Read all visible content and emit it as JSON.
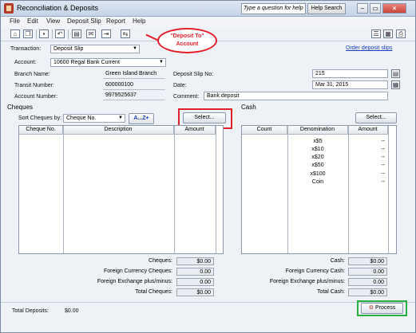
{
  "window": {
    "title": "Reconciliation & Deposits"
  },
  "help": {
    "placeholder": "Type a question for help",
    "search_label": "Help Search"
  },
  "window_controls": {
    "minimize": "–",
    "restore": "▭",
    "close": "×"
  },
  "menu": [
    "File",
    "Edit",
    "View",
    "Deposit Slip",
    "Report",
    "Help"
  ],
  "transaction": {
    "label": "Transaction:",
    "value": "Deposit Slip"
  },
  "order_link": "Order deposit slips",
  "callout": {
    "line1": "\"Deposit To\"",
    "line2": "Account"
  },
  "account": {
    "label": "Account:",
    "value": "10600 Regal Bank Current",
    "branch_label": "Branch Name:",
    "branch_value": "Green Island Branch",
    "transit_label": "Transit Number:",
    "transit_value": "600000100",
    "number_label": "Account Number:",
    "number_value": "9979525637"
  },
  "slip": {
    "number_label": "Deposit Slip No:",
    "number_value": "215",
    "date_label": "Date:",
    "date_value": "Mar 31, 2015",
    "comment_label": "Comment:",
    "comment_value": "Bank deposit"
  },
  "cheques": {
    "title": "Cheques",
    "sort_label": "Sort Cheques by:",
    "sort_value": "Cheque No.",
    "sort_button": "A...Z+",
    "select_button": "Select...",
    "columns": [
      "Cheque No.",
      "Description",
      "Amount"
    ],
    "summary": [
      {
        "label": "Cheques:",
        "value": "$0.00"
      },
      {
        "label": "Foreign Currency Cheques:",
        "value": "0.00"
      },
      {
        "label": "Foreign Exchange plus/minus:",
        "value": "0.00"
      },
      {
        "label": "Total Cheques:",
        "value": "$0.00"
      }
    ]
  },
  "cash": {
    "title": "Cash",
    "select_button": "Select...",
    "columns": [
      "Count",
      "Denomination",
      "Amount"
    ],
    "rows": [
      {
        "denom": "x$5",
        "amount": "--"
      },
      {
        "denom": "x$10",
        "amount": "--"
      },
      {
        "denom": "x$20",
        "amount": "--"
      },
      {
        "denom": "x$50",
        "amount": "--"
      },
      {
        "denom": "x$100",
        "amount": "--"
      },
      {
        "denom": "Coin",
        "amount": "--"
      }
    ],
    "summary": [
      {
        "label": "Cash:",
        "value": "$0.00"
      },
      {
        "label": "Foreign Currency Cash:",
        "value": "0.00"
      },
      {
        "label": "Foreign Exchange plus/minus:",
        "value": "0.00"
      },
      {
        "label": "Total Cash:",
        "value": "$0.00"
      }
    ]
  },
  "footer": {
    "total_label": "Total Deposits:",
    "total_value": "$0.00",
    "process_button": "Process"
  },
  "colors": {
    "highlight_red": "#e0202a",
    "highlight_green": "#28b040",
    "link_blue": "#1a3dc0"
  }
}
